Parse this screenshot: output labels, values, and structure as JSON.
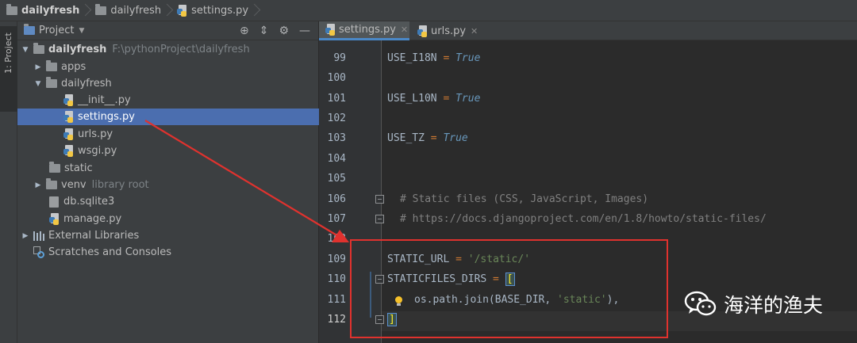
{
  "breadcrumb": {
    "items": [
      "dailyfresh",
      "dailyfresh",
      "settings.py"
    ]
  },
  "tool_strip": {
    "project_tab_label": "1: Project"
  },
  "project_panel": {
    "header_label": "Project",
    "tree": {
      "root": {
        "name": "dailyfresh",
        "path": "F:\\pythonProject\\dailyfresh"
      },
      "apps": "apps",
      "dailyfresh_pkg": "dailyfresh",
      "init": "__init__.py",
      "settings": "settings.py",
      "urls": "urls.py",
      "wsgi": "wsgi.py",
      "static": "static",
      "venv": {
        "name": "venv",
        "note": "library root"
      },
      "db": "db.sqlite3",
      "manage": "manage.py",
      "external_libraries": "External Libraries",
      "scratches": "Scratches and Consoles"
    }
  },
  "editor": {
    "tabs": [
      {
        "label": "settings.py",
        "active": true
      },
      {
        "label": "urls.py",
        "active": false
      }
    ],
    "line_numbers": [
      "99",
      "100",
      "101",
      "102",
      "103",
      "104",
      "105",
      "106",
      "107",
      "108",
      "109",
      "110",
      "111",
      "112"
    ],
    "current_line": "112",
    "code": {
      "l99": {
        "name": "USE_I18N",
        "op": " = ",
        "value": "True"
      },
      "l101": {
        "name": "USE_L10N",
        "op": " = ",
        "value": "True"
      },
      "l103": {
        "name": "USE_TZ",
        "op": " = ",
        "value": "True"
      },
      "l106": "# Static files (CSS, JavaScript, Images)",
      "l107": "# https://docs.djangoproject.com/en/1.8/howto/static-files/",
      "l109": {
        "name": "STATIC_URL",
        "op": " = ",
        "value": "'/static/'"
      },
      "l110": {
        "name": "STATICFILES_DIRS",
        "op": " = ",
        "bracket": "["
      },
      "l111": {
        "call": "os.path.join(BASE_DIR, ",
        "arg": "'static'",
        "tail": "),"
      },
      "l112": {
        "bracket": "]"
      }
    }
  },
  "annotation": {
    "color": "#e0322e"
  },
  "watermark": {
    "text": "海洋的渔夫"
  },
  "colors": {
    "selection": "#4b6eaf",
    "keyword": "#6897bb",
    "operator": "#cc7832",
    "string": "#6a8759",
    "comment": "#808080"
  }
}
